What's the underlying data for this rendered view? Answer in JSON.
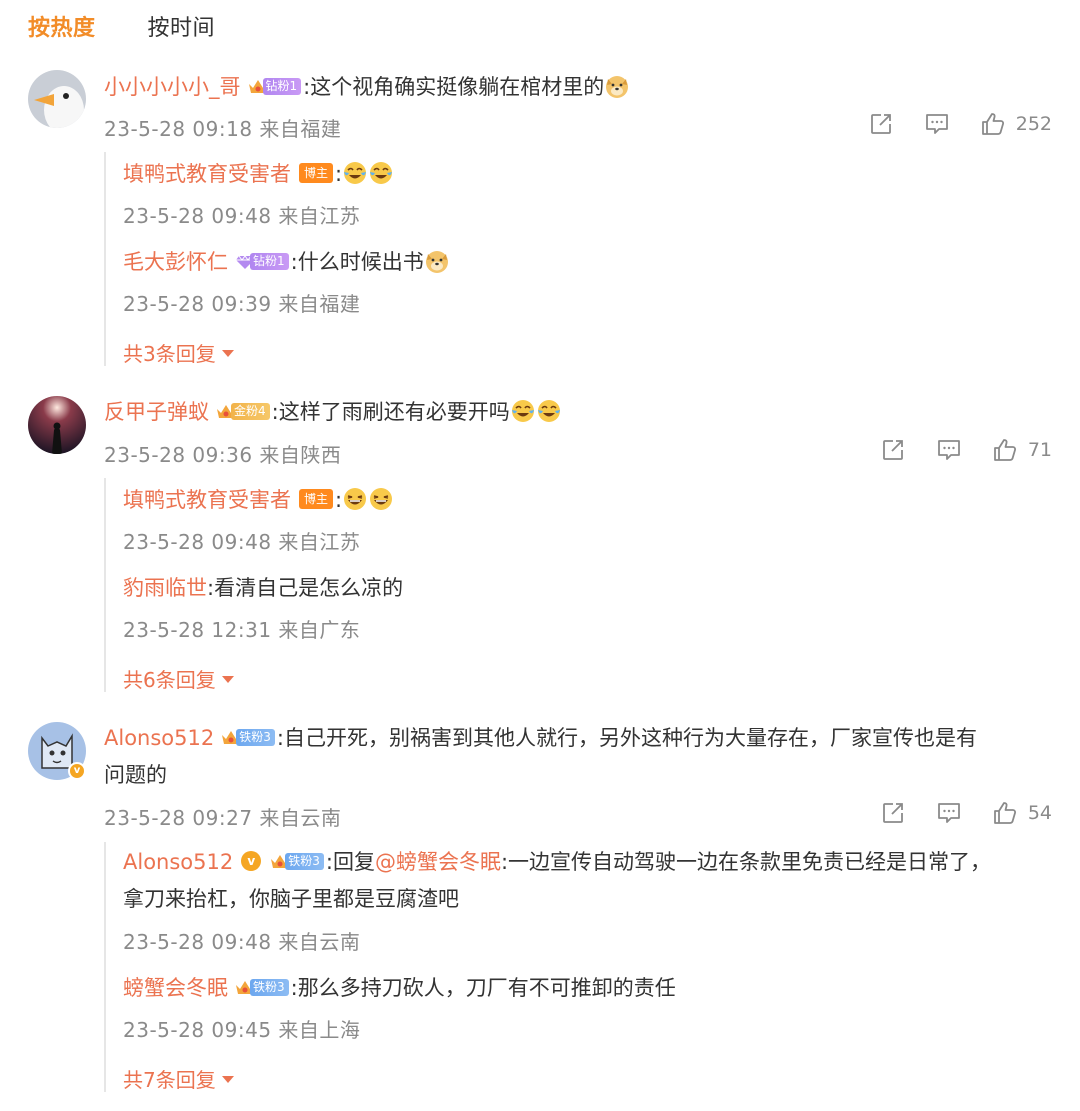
{
  "tabs": {
    "hot": "按热度",
    "time": "按时间"
  },
  "comments": [
    {
      "user": "小小小小小_哥",
      "fan_level": "钻粉1",
      "text": ":这个视角确实挺像躺在棺材里的",
      "time": "23-5-28 09:18",
      "location": "来自福建",
      "likes": "252",
      "replies": [
        {
          "user": "填鸭式教育受害者",
          "tag": "博主",
          "text": ":",
          "time": "23-5-28 09:48",
          "location": "来自江苏"
        },
        {
          "user": "毛大彭怀仁",
          "fan_level": "钻粉1",
          "text": ":什么时候出书",
          "time": "23-5-28 09:39",
          "location": "来自福建"
        }
      ],
      "more": "共3条回复"
    },
    {
      "user": "反甲子弹蚁",
      "fan_level": "金粉4",
      "text": ":这样了雨刷还有必要开吗",
      "time": "23-5-28 09:36",
      "location": "来自陕西",
      "likes": "71",
      "replies": [
        {
          "user": "填鸭式教育受害者",
          "tag": "博主",
          "text": ":",
          "time": "23-5-28 09:48",
          "location": "来自江苏"
        },
        {
          "user": "豹雨临世",
          "text": ":看清自己是怎么凉的",
          "time": "23-5-28 12:31",
          "location": "来自广东"
        }
      ],
      "more": "共6条回复"
    },
    {
      "user": "Alonso512",
      "fan_level": "铁粉3",
      "text_line1": ":自己开死，别祸害到其他人就行，另外这种行为大量存在，厂家宣传也是有",
      "text_line2": "问题的",
      "time": "23-5-28 09:27",
      "location": "来自云南",
      "likes": "54",
      "replies": [
        {
          "user": "Alonso512",
          "fan_level": "铁粉3",
          "reply_prefix": ":回复",
          "reply_to": "@螃蟹会冬眠",
          "text_line1": ":一边宣传自动驾驶一边在条款里免责已经是日常了，",
          "text_line2": "拿刀来抬杠，你脑子里都是豆腐渣吧",
          "time": "23-5-28 09:48",
          "location": "来自云南"
        },
        {
          "user": "螃蟹会冬眠",
          "fan_level": "铁粉3",
          "text": ":那么多持刀砍人，刀厂有不可推卸的责任",
          "time": "23-5-28 09:45",
          "location": "来自上海"
        }
      ],
      "more": "共7条回复"
    }
  ],
  "colors": {
    "accent": "#f28c28",
    "username": "#eb7350",
    "meta": "#8a8a8a"
  },
  "icons": [
    "share-icon",
    "comment-icon",
    "thumbs-up-icon",
    "crown-icon",
    "doge-emoji",
    "laugh-cry-emoji"
  ]
}
